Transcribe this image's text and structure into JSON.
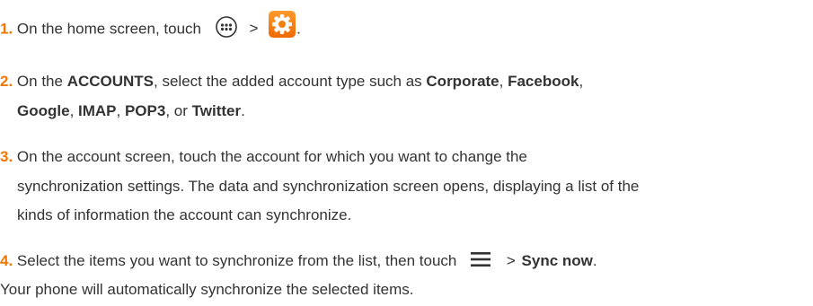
{
  "steps": [
    {
      "number": "1.",
      "parts": {
        "t1": "On the home screen, touch",
        "sep": ">",
        "end": "."
      },
      "icons": [
        "apps-icon",
        "settings-icon"
      ]
    },
    {
      "number": "2.",
      "parts": {
        "t1": "On the ",
        "b1": "ACCOUNTS",
        "t2": ", select the added account type such as ",
        "b2": "Corporate",
        "t3": ", ",
        "b3": "Facebook",
        "t4": ",",
        "b4": "Google",
        "t5": ", ",
        "b5": "IMAP",
        "t6": ", ",
        "b6": "POP3",
        "t7": ", or ",
        "b7": "Twitter",
        "t8": "."
      }
    },
    {
      "number": "3.",
      "lines": [
        "On the account screen, touch the account for which you want to change the",
        "synchronization settings. The data and synchronization screen opens, displaying a list of the",
        "kinds of information the account can synchronize."
      ]
    },
    {
      "number": "4.",
      "parts": {
        "t1": "Select the items you want to synchronize from the list, then touch",
        "sep": ">",
        "b1": "Sync now",
        "end": "."
      },
      "icons": [
        "menu-icon"
      ]
    }
  ],
  "footer": "Your phone will automatically synchronize the selected items.",
  "colors": {
    "step_number": "#f07800",
    "text": "#333333",
    "settings_icon_bg": "#f07800"
  }
}
